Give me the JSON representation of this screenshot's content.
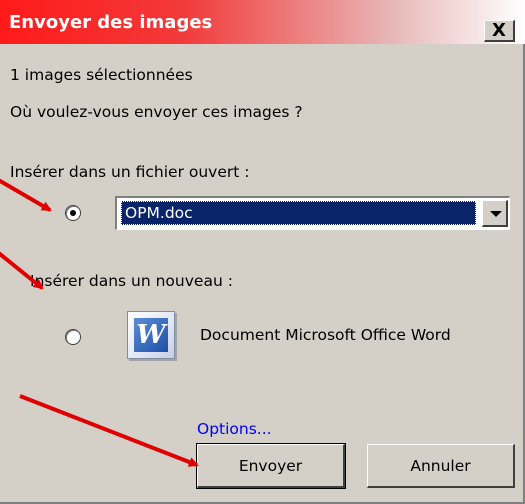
{
  "window": {
    "title": "Envoyer des images",
    "close_glyph": "X"
  },
  "info": {
    "count_text": "1 images sélectionnées",
    "question": "Où voulez-vous envoyer ces images ?"
  },
  "option_open_file": {
    "label": "Insérer dans un fichier ouvert :",
    "selected": true,
    "combo_value": "OPM.doc"
  },
  "option_new": {
    "label": "Insérer dans un nouveau :",
    "selected": false,
    "app_name": "Document Microsoft Office Word",
    "icon_glyph": "W"
  },
  "links": {
    "options": "Options..."
  },
  "buttons": {
    "send": "Envoyer",
    "cancel": "Annuler"
  },
  "colors": {
    "title_red": "#ff1a1a",
    "selection_blue": "#0a246a",
    "annotation_arrow": "#e00000",
    "link_blue": "#0000ff"
  }
}
